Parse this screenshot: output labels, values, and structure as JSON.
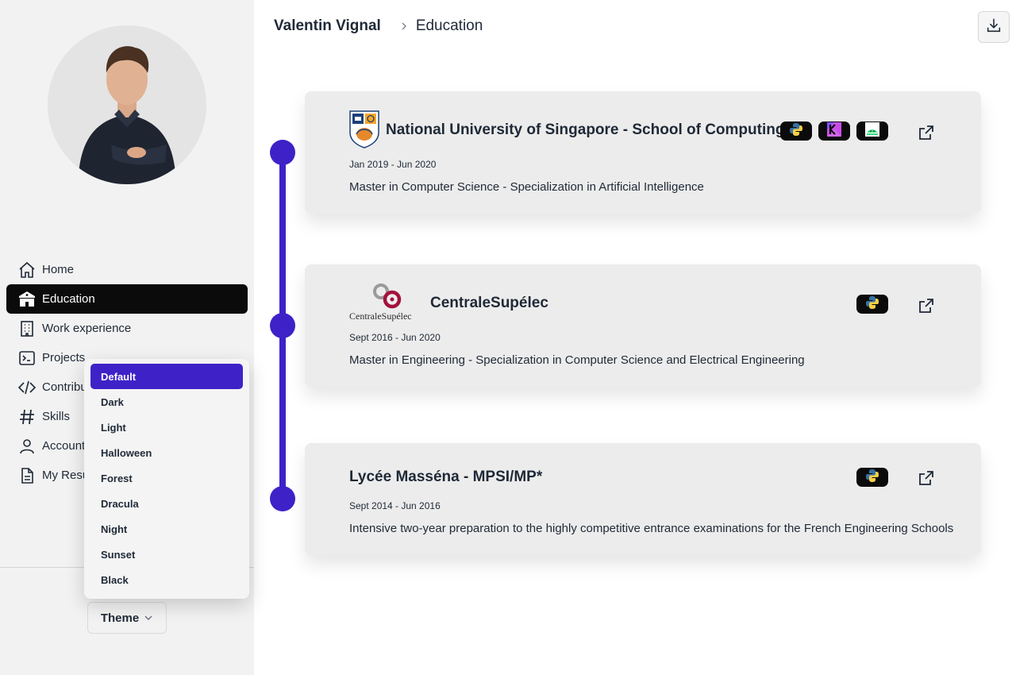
{
  "breadcrumb": {
    "owner": "Valentin Vignal",
    "current": "Education"
  },
  "nav": {
    "items": [
      {
        "label": "Home",
        "icon": "home-icon"
      },
      {
        "label": "Education",
        "icon": "school-icon"
      },
      {
        "label": "Work experience",
        "icon": "building-icon"
      },
      {
        "label": "Projects",
        "icon": "terminal-icon"
      },
      {
        "label": "Contributions",
        "icon": "code-icon"
      },
      {
        "label": "Skills",
        "icon": "hash-icon"
      },
      {
        "label": "Account",
        "icon": "user-icon"
      },
      {
        "label": "My Resume",
        "icon": "document-icon"
      }
    ],
    "active": "Education"
  },
  "theme": {
    "button_label": "Theme",
    "options": [
      "Default",
      "Dark",
      "Light",
      "Halloween",
      "Forest",
      "Dracula",
      "Night",
      "Sunset",
      "Black"
    ],
    "selected": "Default"
  },
  "education": [
    {
      "school": "National University of Singapore - School of Computing",
      "dates": "Jan 2019 - Jun 2020",
      "description": "Master in Computer Science - Specialization in Artificial Intelligence",
      "skills": [
        "python-icon",
        "kotlin-icon",
        "android-icon"
      ]
    },
    {
      "school": "CentraleSupélec",
      "logo_text": "CentraleSupélec",
      "dates": "Sept 2016 - Jun 2020",
      "description": "Master in Engineering - Specialization in Computer Science and Electrical Engineering",
      "skills": [
        "python-icon"
      ]
    },
    {
      "school": "Lycée Masséna - MPSI/MP*",
      "dates": "Sept 2014 - Jun 2016",
      "description": "Intensive two-year preparation to the highly competitive entrance examinations for the French Engineering Schools",
      "skills": [
        "python-icon"
      ]
    }
  ],
  "colors": {
    "accent": "#3e22c8",
    "sidebar": "#f2f2f2",
    "card": "#ececec",
    "active": "#0b0b0b"
  }
}
